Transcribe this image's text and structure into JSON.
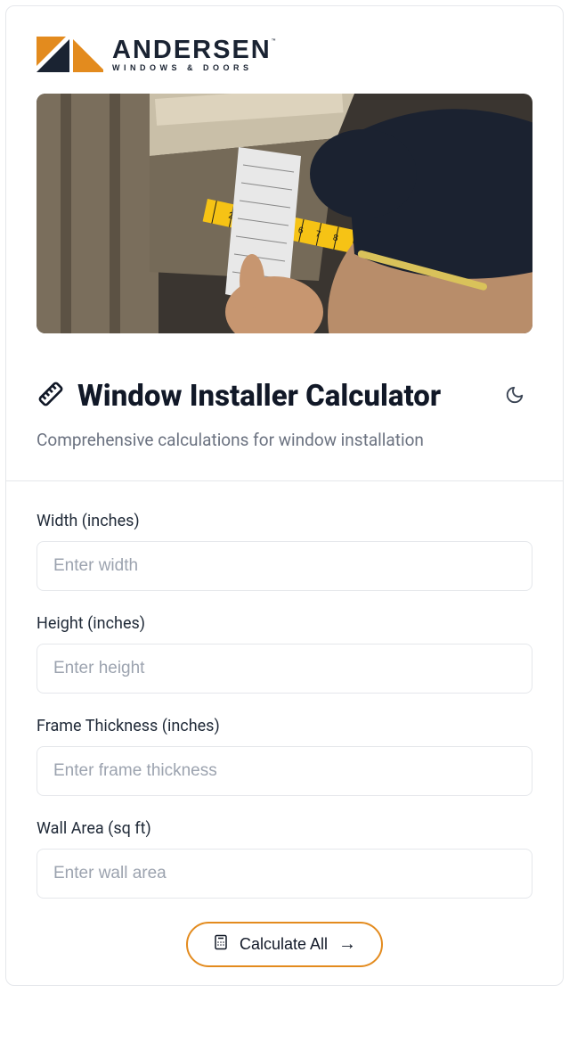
{
  "brand": {
    "name": "ANDERSEN",
    "tagline": "WINDOWS & DOORS"
  },
  "title": "Window Installer Calculator",
  "subtitle": "Comprehensive calculations for window installation",
  "fields": {
    "width": {
      "label": "Width (inches)",
      "placeholder": "Enter width"
    },
    "height": {
      "label": "Height (inches)",
      "placeholder": "Enter height"
    },
    "frame": {
      "label": "Frame Thickness (inches)",
      "placeholder": "Enter frame thickness"
    },
    "wall": {
      "label": "Wall Area (sq ft)",
      "placeholder": "Enter wall area"
    }
  },
  "button": {
    "label": "Calculate All"
  }
}
